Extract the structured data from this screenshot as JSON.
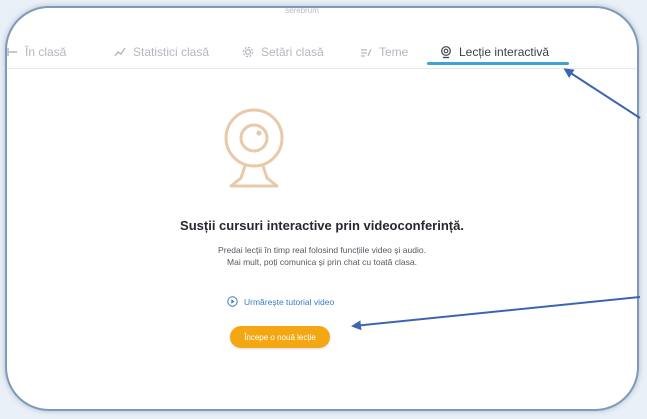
{
  "header": {
    "cut_text": "serebrum"
  },
  "tabs": [
    {
      "label": "În clasă",
      "icon": "arrow-left-icon",
      "active": false
    },
    {
      "label": "Statistici clasă",
      "icon": "chart-line-icon",
      "active": false
    },
    {
      "label": "Setări clasă",
      "icon": "gear-icon",
      "active": false
    },
    {
      "label": "Teme",
      "icon": "list-edit-icon",
      "active": false
    },
    {
      "label": "Lecție interactivă",
      "icon": "webcam-icon",
      "active": true
    }
  ],
  "main": {
    "headline": "Susții cursuri interactive prin videoconferință.",
    "description_line1": "Predai lecții în timp real folosind funcțiile video și audio.",
    "description_line2": "Mai mult, poți comunica și prin chat cu toată clasa.",
    "tutorial_link": "Urmărește tutorial video",
    "start_button": "Începe o nouă lecție"
  },
  "colors": {
    "accent_orange": "#f3a712",
    "tab_underline": "#3fa2d6",
    "annotation_arrow": "#3c64b4",
    "icon_illustration": "#e8c9a8"
  }
}
